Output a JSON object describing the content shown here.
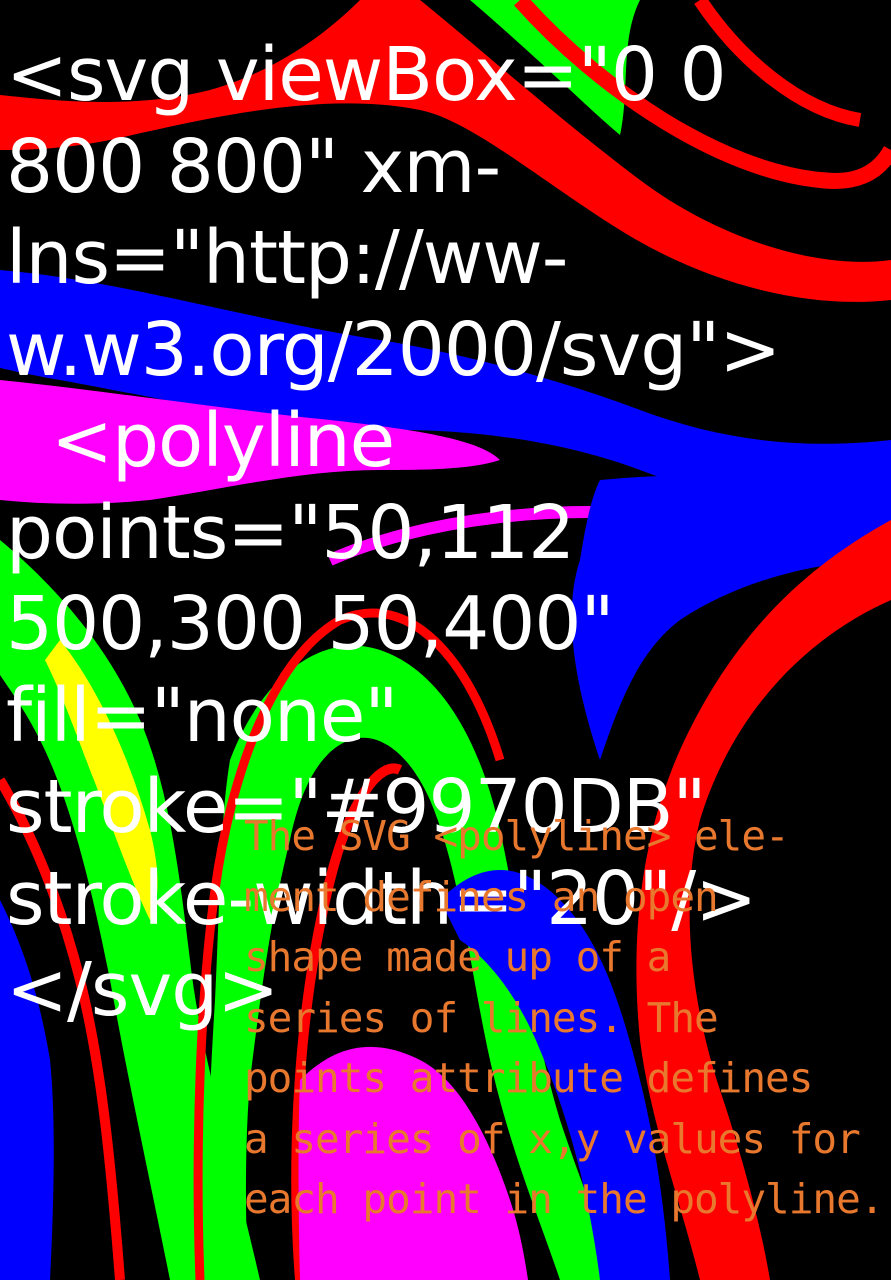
{
  "code_lines": [
    "<svg viewBox=\"0 0",
    "800 800\" xm-",
    "lns=\"http://ww-",
    "w.w3.org/2000/svg\">",
    "  <polyline",
    "points=\"50,112",
    "500,300 50,400\"",
    "fill=\"none\"",
    "stroke=\"#9970DB\"",
    "stroke-width=\"20\"/>",
    "</svg>"
  ],
  "caption_lines": [
    "The SVG <polyline> ele-",
    "ment defines an open",
    "shape made up of a",
    "series of lines. The",
    "points attribute defines",
    "a series of x,y values for",
    "each point in the polyline."
  ],
  "colors": {
    "background": "#000000",
    "code_text": "#ffffff",
    "caption_text": "#e8782e",
    "swirl_red": "#ff0000",
    "swirl_blue": "#0000ff",
    "swirl_magenta": "#ff00ff",
    "swirl_green": "#00ff00",
    "swirl_yellow": "#ffff00"
  }
}
